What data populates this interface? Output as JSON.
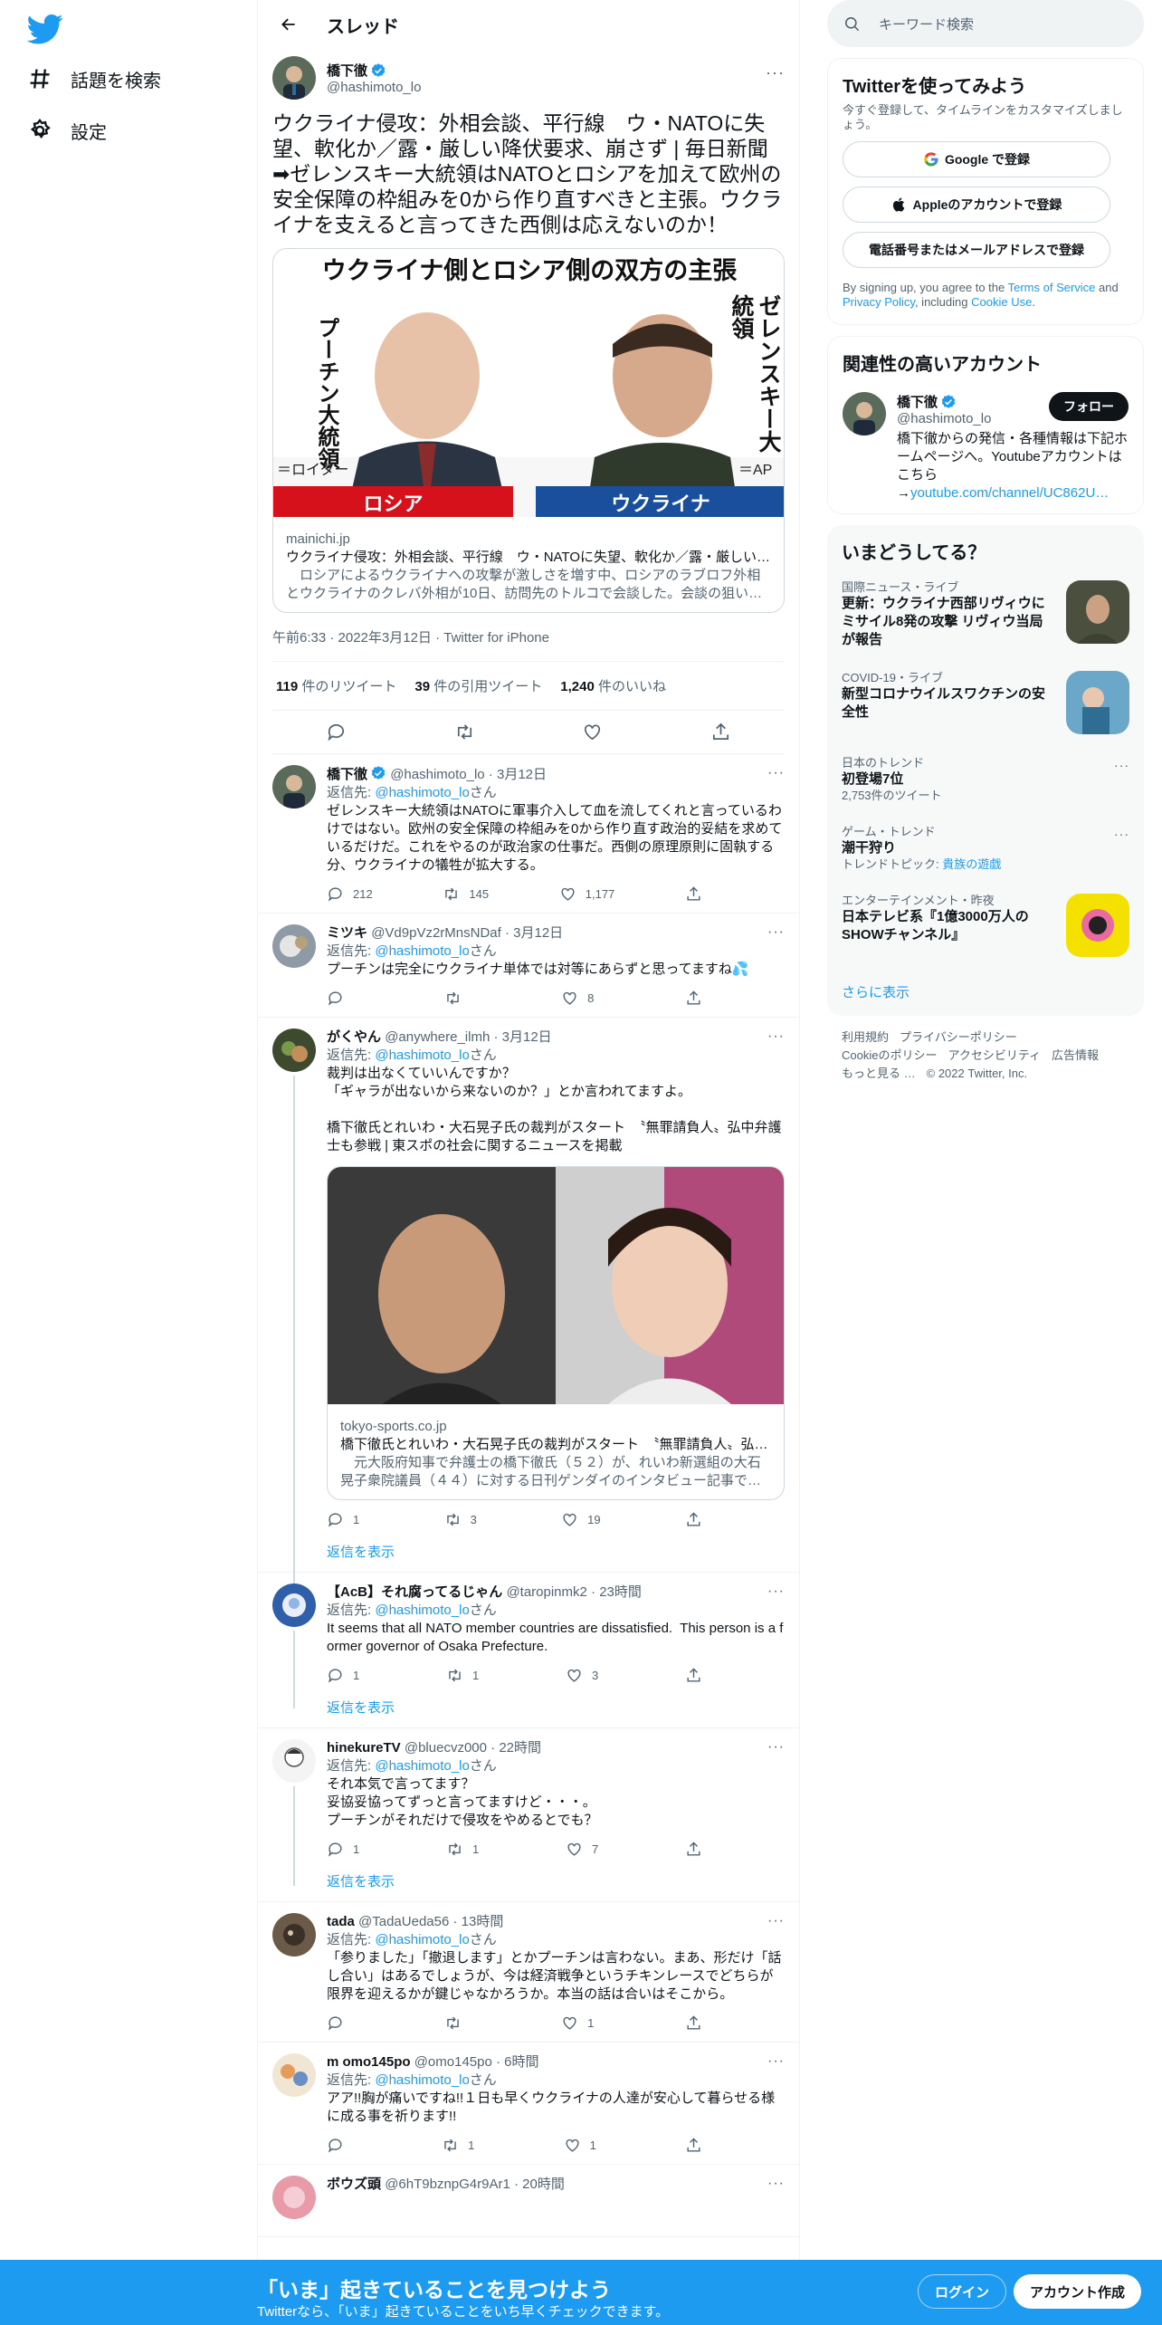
{
  "colors": {
    "accent": "#1d9bf0",
    "text": "#0f1419",
    "muted": "#536471"
  },
  "nav": {
    "explore": "話題を検索",
    "settings": "設定"
  },
  "header": {
    "title": "スレッド"
  },
  "main_tweet": {
    "name": "橋下徹",
    "handle": "@hashimoto_lo",
    "text": "ウクライナ侵攻：外相会談、平行線　ウ・NATOに失望、軟化か／露・厳しい降伏要求、崩さず | 毎日新聞\n➡ゼレンスキー大統領はNATOとロシアを加えて欧州の安全保障の枠組みを0から作り直すべきと主張。ウクライナを支えると言ってきた西側は応えないのか！",
    "card": {
      "banner": "ウクライナ側とロシア側の双方の主張",
      "left_label": "プーチン大統領",
      "right_label": "ゼレンスキー大統領",
      "left_credit": "＝ロイター",
      "right_credit": "＝AP",
      "left_tag": "ロシア",
      "right_tag": "ウクライナ",
      "domain": "mainichi.jp",
      "title": "ウクライナ侵攻：外相会談、平行線　ウ・NATOに失望、軟化か／露・厳しい降伏要求、崩さず",
      "desc": "　ロシアによるウクライナへの攻撃が激しさを増す中、ロシアのラブロフ外相とウクライナのクレバ外相が10日、訪問先のトルコで会談した。会談の狙いは？"
    },
    "timestamp": "午前6:33 · 2022年3月12日 · Twitter for iPhone",
    "stats": {
      "retweets": "119",
      "retweets_label": "件のリツイート",
      "quotes": "39",
      "quotes_label": "件の引用ツイート",
      "likes": "1,240",
      "likes_label": "件のいいね"
    }
  },
  "replying_label": "返信先: ",
  "san": "さん",
  "show_replies": "返信を表示",
  "replies": [
    {
      "name": "橋下徹",
      "handle": "@hashimoto_lo",
      "time": "3月12日",
      "to": "@hashimoto_lo",
      "text": "ゼレンスキー大統領はNATOに軍事介入して血を流してくれと言っているわけではない。欧州の安全保障の枠組みを0から作り直す政治的妥結を求めているだけだ。これをやるのが政治家の仕事だ。西側の原理原則に固執する分、ウクライナの犠牲が拡大する。",
      "replies": "212",
      "retweets": "145",
      "likes": "1,177"
    },
    {
      "name": "ミツキ",
      "handle": "@Vd9pVz2rMnsNDaf",
      "time": "3月12日",
      "to": "@hashimoto_lo",
      "text": "プーチンは完全にウクライナ単体では対等にあらずと思ってますね💦",
      "replies": "",
      "retweets": "",
      "likes": "8"
    },
    {
      "name": "がくやん",
      "handle": "@anywhere_ilmh",
      "time": "3月12日",
      "to": "@hashimoto_lo",
      "text": "裁判は出なくていいんですか？\n「ギャラが出ないから来ないのか？」とか言われてますよ。\n\n橋下徹氏とれいわ・大石晃子氏の裁判がスタート　〝無罪請負人〟弘中弁護士も参戦 | 東スポの社会に関するニュースを掲載",
      "card": {
        "domain": "tokyo-sports.co.jp",
        "title": "橋下徹氏とれいわ・大石晃子氏の裁判がスタート　〝無罪請負人〟弘中弁護士も参戦",
        "desc": "　元大阪府知事で弁護士の橋下徹氏（５２）が、れいわ新選組の大石晃子衆院議員（４４）に対する日刊ゲンダイのインタビュー記事で名誉毀損されたとして"
      },
      "replies": "1",
      "retweets": "3",
      "likes": "19"
    },
    {
      "name": "【AcB】それ腐ってるじゃん",
      "handle": "@taropinmk2",
      "time": "23時間",
      "to": "@hashimoto_lo",
      "text": "It seems that all NATO member countries are dissatisfied.  This person is a former governor of Osaka Prefecture.",
      "replies": "1",
      "retweets": "1",
      "likes": "3"
    },
    {
      "name": "hinekureTV",
      "handle": "@bluecvz000",
      "time": "22時間",
      "to": "@hashimoto_lo",
      "text": "それ本気で言ってます？\n妥協妥協ってずっと言ってますけど・・・。\nプーチンがそれだけで侵攻をやめるとでも？",
      "replies": "1",
      "retweets": "1",
      "likes": "7"
    },
    {
      "name": "tada",
      "handle": "@TadaUeda56",
      "time": "13時間",
      "to": "@hashimoto_lo",
      "text": "「参りました」「撤退します」とかプーチンは言わない。まあ、形だけ「話し合い」はあるでしょうが、今は経済戦争というチキンレースでどちらが限界を迎えるかが鍵じゃなかろうか。本当の話は合いはそこから。",
      "replies": "",
      "retweets": "",
      "likes": "1"
    },
    {
      "name": "m omo145po",
      "handle": "@omo145po",
      "time": "6時間",
      "to": "@hashimoto_lo",
      "text": "アア!!胸が痛いですね!!１日も早くウクライナの人達が安心して暮らせる様に成る事を祈ります!!",
      "replies": "",
      "retweets": "1",
      "likes": "1"
    },
    {
      "name": "ボウズ頭",
      "handle": "@6hT9bznpG4r9Ar1",
      "time": "20時間",
      "to": "@hashimoto_lo",
      "text": "",
      "replies": "",
      "retweets": "",
      "likes": ""
    }
  ],
  "right": {
    "search_placeholder": "キーワード検索",
    "signup": {
      "title": "Twitterを使ってみよう",
      "sub": "今すぐ登録して、タイムラインをカスタマイズしましょう。",
      "google": "Google で登録",
      "apple": "Appleのアカウントで登録",
      "phone": "電話番号またはメールアドレスで登録",
      "terms_pre": "By signing up, you agree to the ",
      "terms_tos": "Terms of Service",
      "terms_and": " and ",
      "terms_pp": "Privacy Policy",
      "terms_inc": ", including ",
      "terms_cookie": "Cookie Use",
      "terms_end": "."
    },
    "related": {
      "title": "関連性の高いアカウント",
      "name": "橋下徹",
      "handle": "@hashimoto_lo",
      "follow": "フォロー",
      "bio": "橋下徹からの発信・各種情報は下記ホームページへ。Youtubeアカウントはこちら\n→",
      "bio_link": "youtube.com/channel/UC862U…"
    },
    "trends": {
      "title": "いまどうしてる？",
      "items": [
        {
          "meta": "国際ニュース・ライブ",
          "title": "更新：ウクライナ西部リヴィウにミサイル8発の攻撃 リヴィウ当局が報告",
          "sub": ""
        },
        {
          "meta": "COVID-19・ライブ",
          "title": "新型コロナウイルスワクチンの安全性",
          "sub": ""
        },
        {
          "meta": "日本のトレンド",
          "title": "初登場7位",
          "sub": "2,753件のツイート"
        },
        {
          "meta": "ゲーム・トレンド",
          "title": "潮干狩り",
          "sub_pre": "トレンドトピック: ",
          "sub_link": "貴族の遊戯"
        },
        {
          "meta": "エンターテインメント・昨夜",
          "title": "日本テレビ系『1億3000万人のSHOWチャンネル』",
          "sub": ""
        }
      ],
      "show_more": "さらに表示"
    },
    "footer": {
      "terms": "利用規約",
      "privacy": "プライバシーポリシー",
      "cookie": "Cookieのポリシー",
      "access": "アクセシビリティ",
      "ads": "広告情報",
      "more": "もっと見る …",
      "copy": "© 2022 Twitter, Inc."
    }
  },
  "bottom": {
    "title": "「いま」起きていることを見つけよう",
    "sub": "Twitterなら、「いま」起きていることをいち早くチェックできます。",
    "login": "ログイン",
    "signup": "アカウント作成"
  }
}
